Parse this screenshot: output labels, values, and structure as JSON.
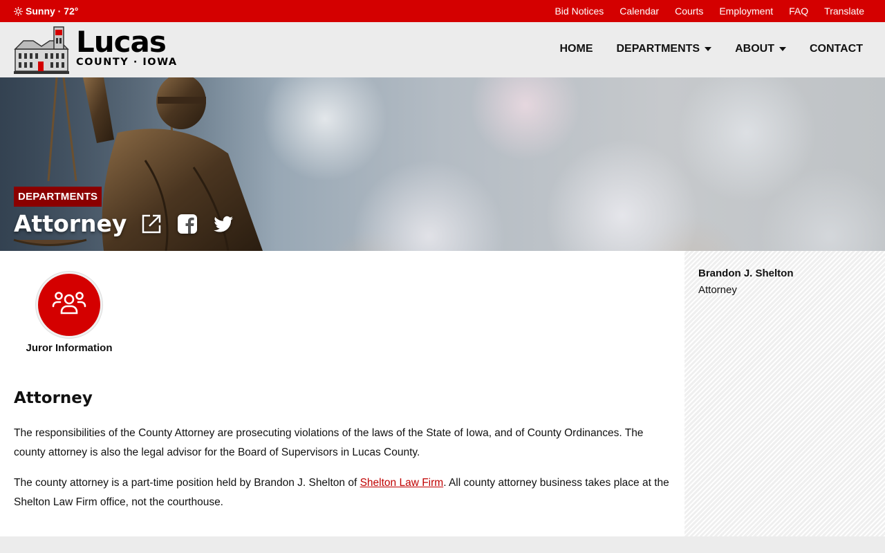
{
  "topbar": {
    "weather": "Sunny · 72°",
    "links": [
      "Bid Notices",
      "Calendar",
      "Courts",
      "Employment",
      "FAQ",
      "Translate"
    ]
  },
  "header": {
    "logo_name": "Lucas",
    "logo_sub": "COUNTY · IOWA",
    "nav": [
      {
        "label": "HOME",
        "dropdown": false
      },
      {
        "label": "DEPARTMENTS",
        "dropdown": true
      },
      {
        "label": "ABOUT",
        "dropdown": true
      },
      {
        "label": "CONTACT",
        "dropdown": false
      }
    ]
  },
  "hero": {
    "badge": "DEPARTMENTS",
    "title": "Attorney",
    "share_icons": [
      "external-link-icon",
      "facebook-icon",
      "twitter-icon"
    ]
  },
  "quick_links": [
    {
      "label": "Juror Information",
      "icon": "users-icon"
    }
  ],
  "content": {
    "heading": "Attorney",
    "para1": "The responsibilities of the County Attorney are prosecuting violations of the laws of the State of Iowa, and of County Ordinances. The county attorney is also the legal advisor for the Board of Supervisors in Lucas County.",
    "para2_before": "The county attorney is a part-time position held by Brandon J. Shelton of ",
    "para2_link": "Shelton Law Firm",
    "para2_after": ". All county attorney business takes place at the Shelton Law Firm office, not the courthouse."
  },
  "sidebar": {
    "name": "Brandon J. Shelton",
    "role": "Attorney"
  },
  "colors": {
    "brand_red": "#d40000",
    "badge_dark_red": "#8b0000",
    "link_red": "#c00000",
    "header_bg": "#ececec"
  }
}
